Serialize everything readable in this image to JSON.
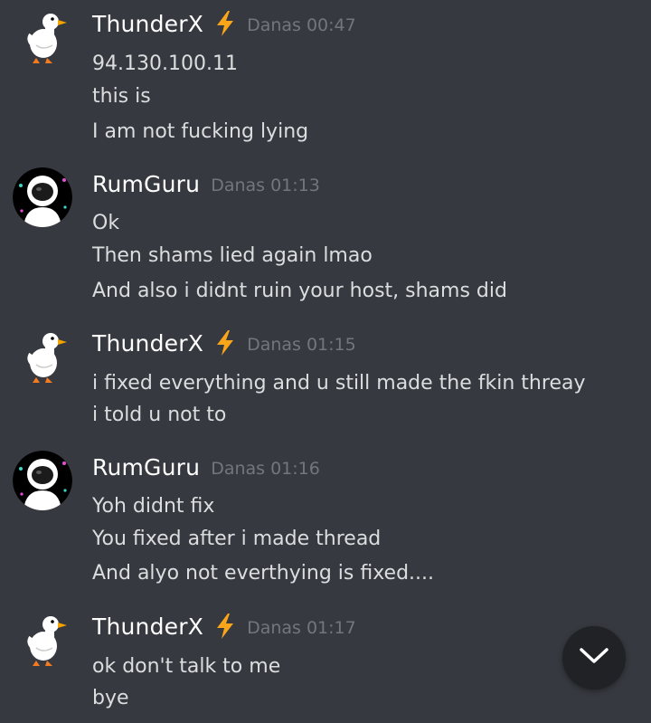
{
  "messages": [
    {
      "author": "ThunderX",
      "avatar_icon": "duck-avatar-icon",
      "badge_icon": "lightning-bolt-icon",
      "timestamp": "Danas 00:47",
      "lines": [
        "94.130.100.11",
        "this is",
        "I am not fucking lying"
      ]
    },
    {
      "author": "RumGuru",
      "avatar_icon": "astronaut-avatar-icon",
      "timestamp": "Danas 01:13",
      "lines": [
        "Ok",
        "Then shams lied again lmao",
        "And also i didnt ruin your host, shams did"
      ]
    },
    {
      "author": "ThunderX",
      "avatar_icon": "duck-avatar-icon",
      "badge_icon": "lightning-bolt-icon",
      "timestamp": "Danas 01:15",
      "lines": [
        "i fixed everything and u still made the fkin threay",
        "i told u not to"
      ]
    },
    {
      "author": "RumGuru",
      "avatar_icon": "astronaut-avatar-icon",
      "timestamp": "Danas 01:16",
      "lines": [
        "Yoh didnt fix",
        "You fixed after i made thread",
        "And alyo not everthying is fixed...."
      ]
    },
    {
      "author": "ThunderX",
      "avatar_icon": "duck-avatar-icon",
      "badge_icon": "lightning-bolt-icon",
      "timestamp": "Danas 01:17",
      "lines": [
        "ok don't talk to me",
        "bye"
      ]
    }
  ],
  "jump_button": {
    "icon": "chevron-down-icon"
  },
  "colors": {
    "background": "#36393f",
    "username": "#ffffff",
    "text": "#dcddde",
    "timestamp": "#72767d",
    "bolt": "#faa61a",
    "jump_button_bg": "#202225"
  }
}
